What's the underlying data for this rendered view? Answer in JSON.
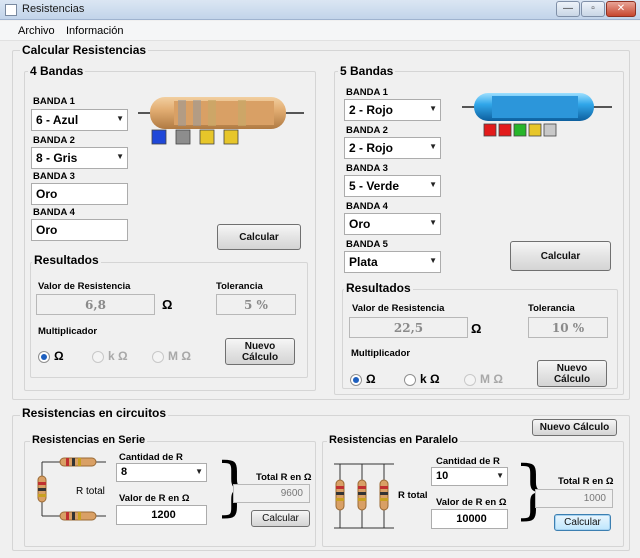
{
  "window": {
    "title": "Resistencias",
    "buttons": {
      "minimize": "—",
      "maximize": "▫",
      "close": "✕"
    }
  },
  "menu": {
    "items": [
      "Archivo",
      "Información"
    ]
  },
  "calc": {
    "title": "Calcular Resistencias",
    "four": {
      "title": "4 Bandas",
      "bands": [
        {
          "label": "BANDA 1",
          "value": "6 - Azul"
        },
        {
          "label": "BANDA 2",
          "value": "8 - Gris"
        },
        {
          "label": "BANDA 3",
          "value": "Oro"
        },
        {
          "label": "BANDA 4",
          "value": "Oro"
        }
      ],
      "band_colors": [
        "#1f47d8",
        "#8d8d8d",
        "#e7c62a",
        "#e7c62a"
      ],
      "calc_button": "Calcular",
      "results": {
        "title": "Resultados",
        "value_label": "Valor de Resistencia",
        "value": "6,8",
        "unit": "Ω",
        "tolerance_label": "Tolerancia",
        "tolerance": "5 %",
        "multiplier_label": "Multiplicador",
        "options": [
          "Ω",
          "k Ω",
          "M Ω"
        ],
        "new_button": "Nuevo Cálculo"
      }
    },
    "five": {
      "title": "5 Bandas",
      "bands": [
        {
          "label": "BANDA 1",
          "value": "2 - Rojo"
        },
        {
          "label": "BANDA 2",
          "value": "2 - Rojo"
        },
        {
          "label": "BANDA 3",
          "value": "5 - Verde"
        },
        {
          "label": "BANDA 4",
          "value": "Oro"
        },
        {
          "label": "BANDA 5",
          "value": "Plata"
        }
      ],
      "band_colors": [
        "#e21b1b",
        "#e21b1b",
        "#27b52b",
        "#e7c62a",
        "#c8c8c8"
      ],
      "calc_button": "Calcular",
      "results": {
        "title": "Resultados",
        "value_label": "Valor de Resistencia",
        "value": "22,5",
        "unit": "Ω",
        "tolerance_label": "Tolerancia",
        "tolerance": "10 %",
        "multiplier_label": "Multiplicador",
        "options": [
          "Ω",
          "k Ω",
          "M Ω"
        ],
        "new_button": "Nuevo Cálculo"
      }
    }
  },
  "circuits": {
    "title": "Resistencias en circuitos",
    "new_button": "Nuevo Cálculo",
    "series": {
      "title": "Resistencias en Serie",
      "r_total_label": "R total",
      "count_label": "Cantidad de R",
      "count_value": "8",
      "value_label": "Valor de R en Ω",
      "value": "1200",
      "total_label": "Total R en Ω",
      "total_value": "9600",
      "calc_button": "Calcular"
    },
    "parallel": {
      "title": "Resistencias en Paralelo",
      "r_total_label": "R total",
      "count_label": "Cantidad de R",
      "count_value": "10",
      "value_label": "Valor de R en Ω",
      "value": "10000",
      "total_label": "Total R en Ω",
      "total_value": "1000",
      "calc_button": "Calcular"
    }
  }
}
